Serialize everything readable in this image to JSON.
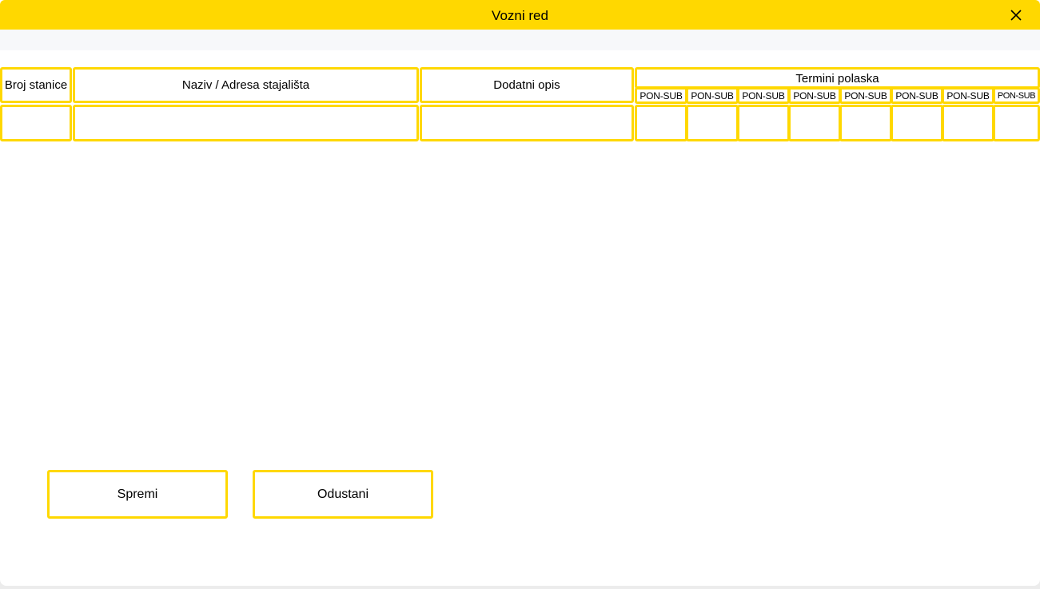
{
  "window": {
    "title": "Vozni red",
    "close_icon": "close-icon"
  },
  "colors": {
    "accent": "#ffd800",
    "background": "#ffffff",
    "strip": "#f7f8fa"
  },
  "table": {
    "headers": {
      "broj_stanice": "Broj stanice",
      "naziv": "Naziv / Adresa stajališta",
      "opis": "Dodatni opis",
      "termini": "Termini polaska"
    },
    "days": [
      "PON-SUB",
      "PON-SUB",
      "PON-SUB",
      "PON-SUB",
      "PON-SUB",
      "PON-SUB",
      "PON-SUB",
      "PON-SUB"
    ],
    "rows": [
      {
        "broj_stanice": "",
        "naziv": "",
        "opis": "",
        "termini": [
          "",
          "",
          "",
          "",
          "",
          "",
          "",
          ""
        ]
      }
    ]
  },
  "buttons": {
    "save": "Spremi",
    "cancel": "Odustani"
  }
}
